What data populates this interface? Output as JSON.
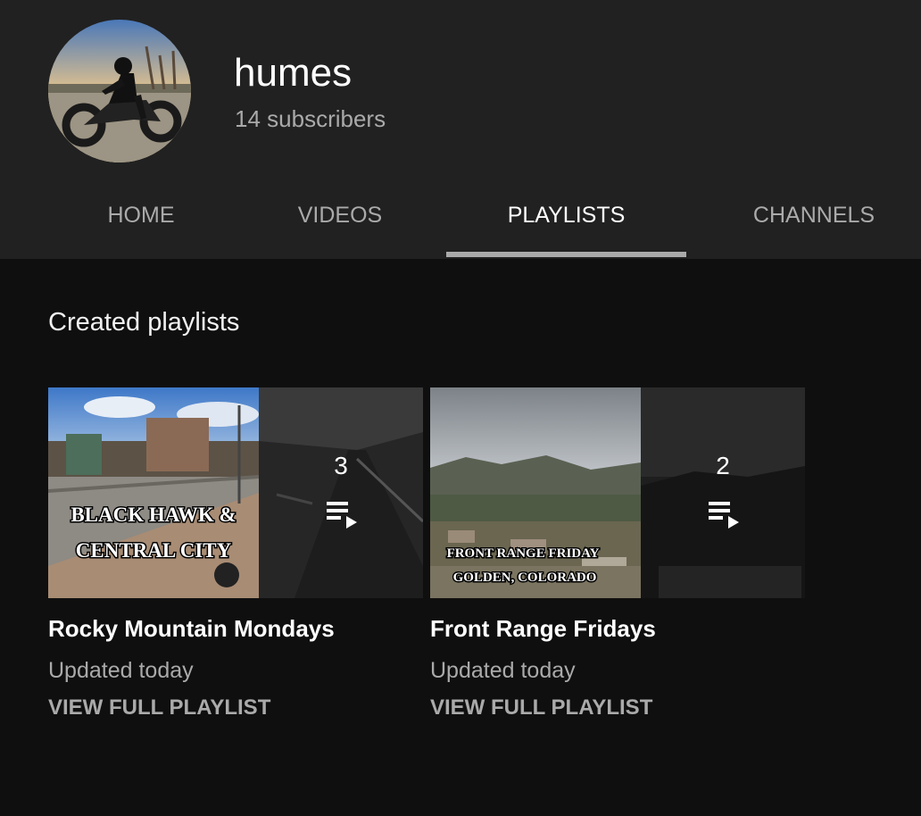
{
  "channel": {
    "name": "humes",
    "subscribers": "14 subscribers"
  },
  "tabs": [
    {
      "label": "HOME",
      "active": false
    },
    {
      "label": "VIDEOS",
      "active": false
    },
    {
      "label": "PLAYLISTS",
      "active": true
    },
    {
      "label": "CHANNELS",
      "active": false
    }
  ],
  "section": {
    "title": "Created playlists"
  },
  "playlists": [
    {
      "title": "Rocky Mountain Mondays",
      "count": "3",
      "updated": "Updated today",
      "link": "VIEW FULL PLAYLIST",
      "thumb_text": [
        "BLACK HAWK &",
        "CENTRAL CITY"
      ]
    },
    {
      "title": "Front Range Fridays",
      "count": "2",
      "updated": "Updated today",
      "link": "VIEW FULL PLAYLIST",
      "thumb_text": [
        "FRONT RANGE FRIDAY",
        "GOLDEN, COLORADO"
      ]
    }
  ],
  "icons": {
    "playlist_overlay": "playlist-play-icon"
  },
  "colors": {
    "header_bg": "#212121",
    "page_bg": "#0f0f0f",
    "text_primary": "#ffffff",
    "text_secondary": "#aaaaaa",
    "tab_indicator": "#aaaaaa"
  }
}
